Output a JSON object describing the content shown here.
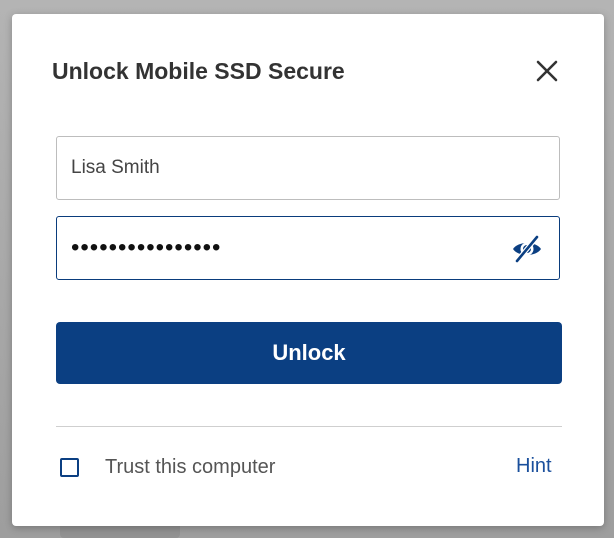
{
  "dialog": {
    "title": "Unlock Mobile SSD Secure",
    "close_icon": "close-icon"
  },
  "form": {
    "username_value": "Lisa Smith",
    "password_value": "••••••••••••••••",
    "password_toggle_icon": "eye-off-icon",
    "unlock_label": "Unlock"
  },
  "footer": {
    "trust_label": "Trust this computer",
    "trust_checked": false,
    "hint_label": "Hint"
  },
  "colors": {
    "primary": "#0b3f82",
    "link": "#1a4f9c",
    "title_text": "#333333",
    "backdrop": "#a9a9a9"
  }
}
